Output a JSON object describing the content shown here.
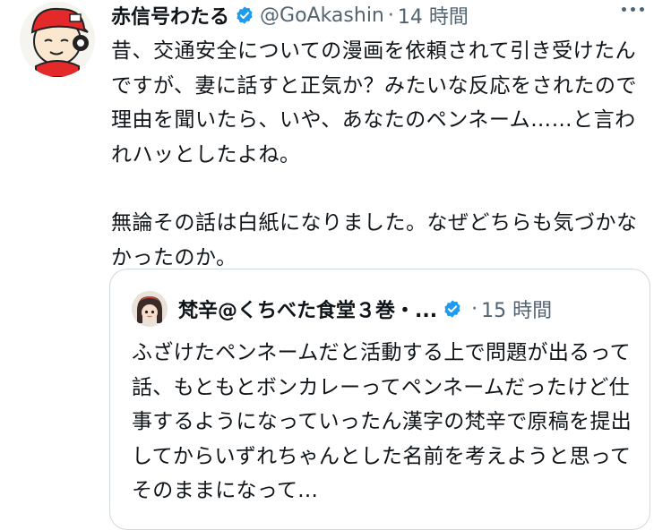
{
  "tweet": {
    "author_name": "赤信号わたる",
    "handle": "@GoAkashin",
    "separator": "·",
    "time": "14 時間",
    "paragraph1": "昔、交通安全についての漫画を依頼されて引き受けたんですが、妻に話すと正気か？みたいな反応をされたので理由を聞いたら、いや、あなたのペンネーム……と言われハッとしたよね。",
    "paragraph2": "無論その話は白紙になりました。なぜどちらも気づかなかったのか。"
  },
  "quoted_tweet": {
    "author_name": "梵辛@くちべた食堂３巻・...",
    "separator": "·",
    "time": "15 時間",
    "text": "ふざけたペンネームだと活動する上で問題が出るって話、もともとボンカレーってペンネームだったけど仕事するようになっていったん漢字の梵辛で原稿を提出してからいずれちゃんとした名前を考えようと思ってそのままになって..."
  },
  "colors": {
    "verified": "#1d9bf0",
    "secondary_text": "#536471",
    "border": "#cfd9de"
  },
  "icons": [
    "verified-badge-icon",
    "more-options-icon"
  ]
}
